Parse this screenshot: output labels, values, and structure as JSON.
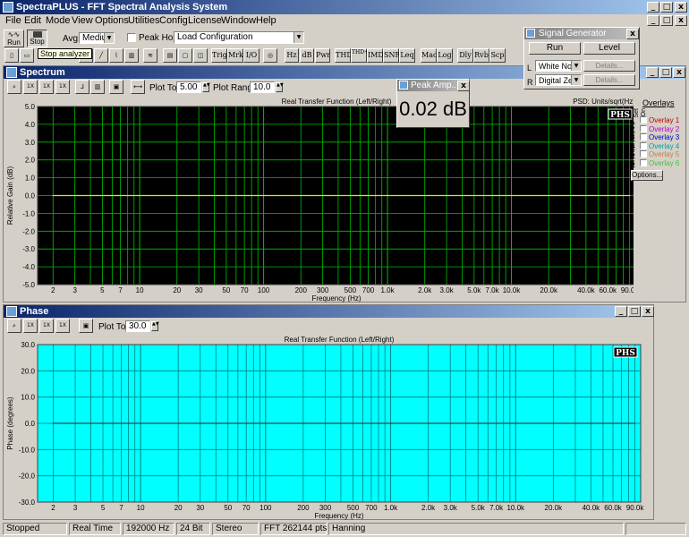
{
  "app": {
    "title": "SpectraPLUS - FFT Spectral Analysis System"
  },
  "menu": [
    "File",
    "Edit",
    "Mode",
    "View",
    "Options",
    "Utilities",
    "Config",
    "License",
    "Window",
    "Help"
  ],
  "toolbar": {
    "run_label": "Run",
    "stop_label": "Stop",
    "tooltip": "Stop analyzer",
    "avg_label": "Avg:",
    "avg_value": "Medium",
    "peak_hold_label": "Peak Hold",
    "load_config": "Load Configuration",
    "text_buttons": [
      "Trig",
      "Mrk",
      "I/O",
      "Hz",
      "dB",
      "Pwr",
      "THD",
      "THD+N",
      "IMD",
      "SNR",
      "Leq",
      "Mac",
      "Log",
      "Dly",
      "Rvb",
      "Scp"
    ]
  },
  "signal_generator": {
    "title": "Signal Generator",
    "run_label": "Run",
    "level_label": "Level",
    "left_label": "L",
    "right_label": "R",
    "left_value": "White Noise",
    "right_value": "Digital Zero",
    "details_label": "Details..."
  },
  "spectrum": {
    "title": "Spectrum",
    "plot_top_label": "Plot Top:",
    "plot_top_value": "5.00",
    "plot_range_label": "Plot Range:",
    "plot_range_value": "10.0",
    "overlays_title": "Overlays",
    "set_label": "Set",
    "on_label": "On",
    "overlays": [
      "Overlay 1",
      "Overlay 2",
      "Overlay 3",
      "Overlay 4",
      "Overlay 5",
      "Overlay 6"
    ],
    "overlay_colors": [
      "#c00000",
      "#c000c0",
      "#0000c0",
      "#00a0a0",
      "#c08040",
      "#40c040"
    ],
    "overlay_numbers": [
      "1",
      "2",
      "3",
      "4",
      "5",
      "6"
    ],
    "options_label": "Options..."
  },
  "peak_amplitude": {
    "title": "Peak Amp...",
    "value": "0.02 dB"
  },
  "phase": {
    "title": "Phase",
    "plot_top_label": "Plot Top:",
    "plot_top_value": "30.0"
  },
  "status_bar": [
    "Stopped",
    "Real Time",
    "192000 Hz",
    "24 Bit",
    "Stereo",
    "FFT 262144 pts",
    "Hanning"
  ],
  "chart_data": [
    {
      "type": "line",
      "title": "Real Transfer Function (Left/Right)",
      "subtitle": "PSD: Units/sqrt(Hz)",
      "watermark": "PHS",
      "xlabel": "Frequency (Hz)",
      "ylabel": "Relative Gain (dB)",
      "x_scale": "log",
      "xlim": [
        1.5,
        100000
      ],
      "ylim": [
        -5.0,
        5.0
      ],
      "yticks": [
        "5.0",
        "4.0",
        "3.0",
        "2.0",
        "1.0",
        "0.0",
        "-1.0",
        "-2.0",
        "-3.0",
        "-4.0",
        "-5.0"
      ],
      "xticks": [
        "2",
        "3",
        "5",
        "7",
        "10",
        "20",
        "30",
        "50",
        "70",
        "100",
        "200",
        "300",
        "500",
        "700",
        "1.0k",
        "2.0k",
        "3.0k",
        "5.0k",
        "7.0k",
        "10.0k",
        "20.0k",
        "40.0k",
        "60.0k",
        "90.0k"
      ],
      "background": "#000000",
      "grid": "#00c000",
      "series": [
        {
          "color": "#e8e800",
          "x": [
            2,
            10,
            100,
            1000,
            10000,
            90000
          ],
          "y": [
            0.0,
            0.0,
            0.0,
            0.0,
            0.0,
            0.0
          ]
        }
      ]
    },
    {
      "type": "line",
      "title": "Real Transfer Function (Left/Right)",
      "watermark": "PHS",
      "xlabel": "Frequency (Hz)",
      "ylabel": "Phase (degrees)",
      "x_scale": "log",
      "xlim": [
        1.5,
        100000
      ],
      "ylim": [
        -30.0,
        30.0
      ],
      "yticks": [
        "30.0",
        "20.0",
        "10.0",
        "0.0",
        "-10.0",
        "-20.0",
        "-30.0"
      ],
      "xticks": [
        "2",
        "3",
        "5",
        "7",
        "10",
        "20",
        "30",
        "50",
        "70",
        "100",
        "200",
        "300",
        "500",
        "700",
        "1.0k",
        "2.0k",
        "3.0k",
        "5.0k",
        "7.0k",
        "10.0k",
        "20.0k",
        "40.0k",
        "60.0k",
        "90.0k"
      ],
      "background": "#00ffff",
      "grid": "#008080",
      "series": [
        {
          "color": "#404040",
          "x": [
            2,
            10,
            100,
            1000,
            10000,
            90000
          ],
          "y": [
            0.0,
            0.0,
            0.0,
            0.0,
            0.0,
            0.0
          ]
        }
      ]
    }
  ]
}
